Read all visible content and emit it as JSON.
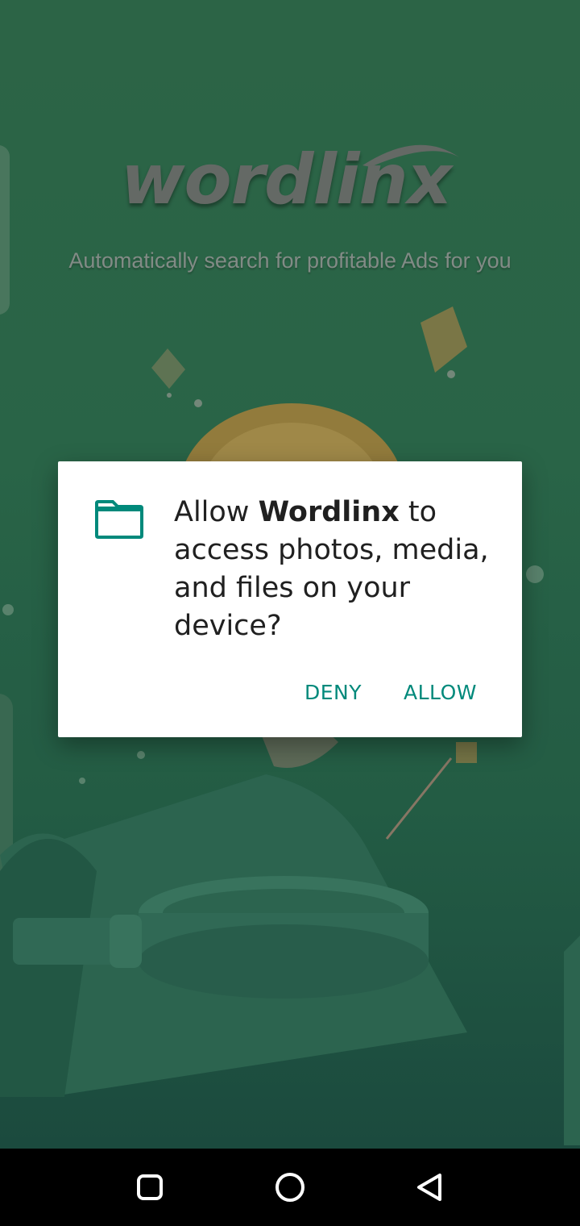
{
  "app": {
    "logo_text": "wordlinx",
    "tagline": "Automatically search for profitable Ads for you"
  },
  "dialog": {
    "icon": "folder-icon",
    "message_prefix": "Allow ",
    "app_name": "Wordlinx",
    "message_suffix": " to access photos, media, and files on your device?",
    "deny_label": "DENY",
    "allow_label": "ALLOW",
    "accent_color": "#00897b"
  },
  "nav_bar": {
    "recents_icon": "square-recents-icon",
    "home_icon": "circle-home-icon",
    "back_icon": "triangle-back-icon"
  }
}
